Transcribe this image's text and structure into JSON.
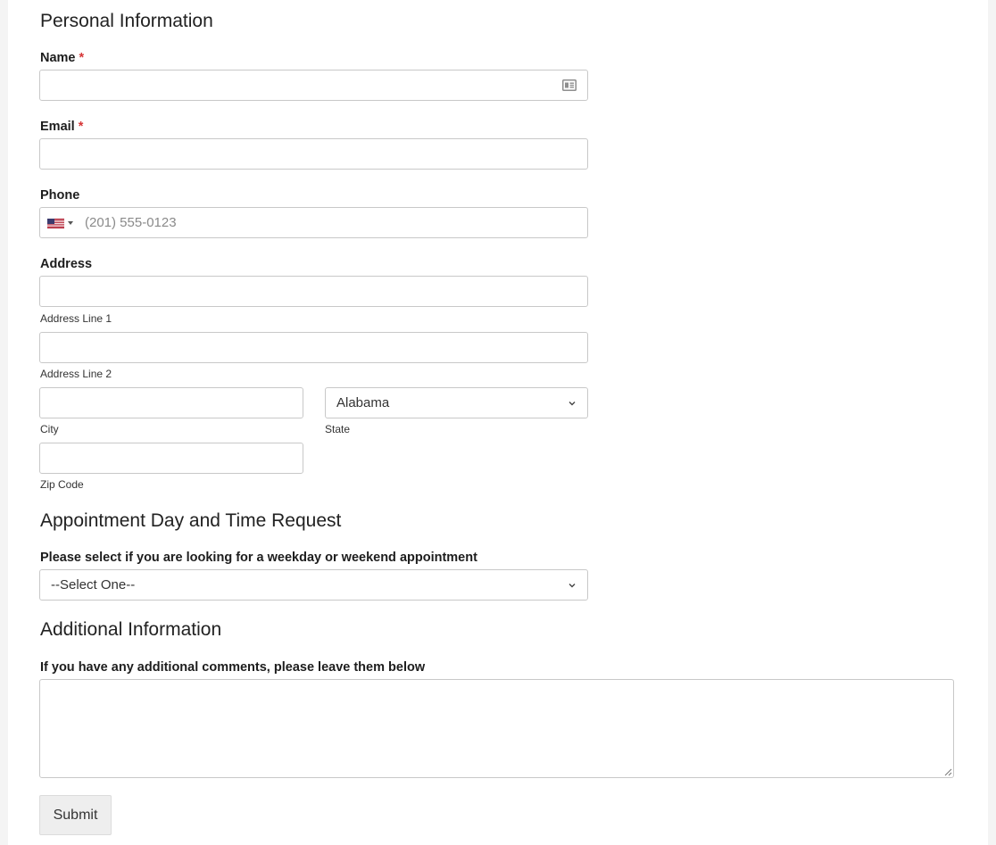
{
  "sections": {
    "personal": "Personal Information",
    "appointment": "Appointment Day and Time Request",
    "additional": "Additional Information"
  },
  "fields": {
    "name": {
      "label": "Name",
      "required_mark": "*",
      "value": ""
    },
    "email": {
      "label": "Email",
      "required_mark": "*",
      "value": ""
    },
    "phone": {
      "label": "Phone",
      "placeholder": "(201) 555-0123",
      "country_icon": "us-flag-icon"
    },
    "address": {
      "label": "Address",
      "line1_sublabel": "Address Line 1",
      "line2_sublabel": "Address Line 2",
      "city_sublabel": "City",
      "state_sublabel": "State",
      "state_value": "Alabama",
      "zip_sublabel": "Zip Code"
    },
    "appointment_type": {
      "label": "Please select if you are looking for a weekday or weekend appointment",
      "value": "--Select One--"
    },
    "comments": {
      "label": "If you have any additional comments, please leave them below",
      "value": ""
    }
  },
  "submit_label": "Submit",
  "colors": {
    "required": "#d63637",
    "border": "#c8c8c8",
    "button_bg": "#eeeeee",
    "page_bg": "#f4f4f4"
  },
  "icons": {
    "name_field": "contact-card-icon",
    "select_arrow": "chevron-down-icon",
    "resize": "resize-grip-icon"
  }
}
